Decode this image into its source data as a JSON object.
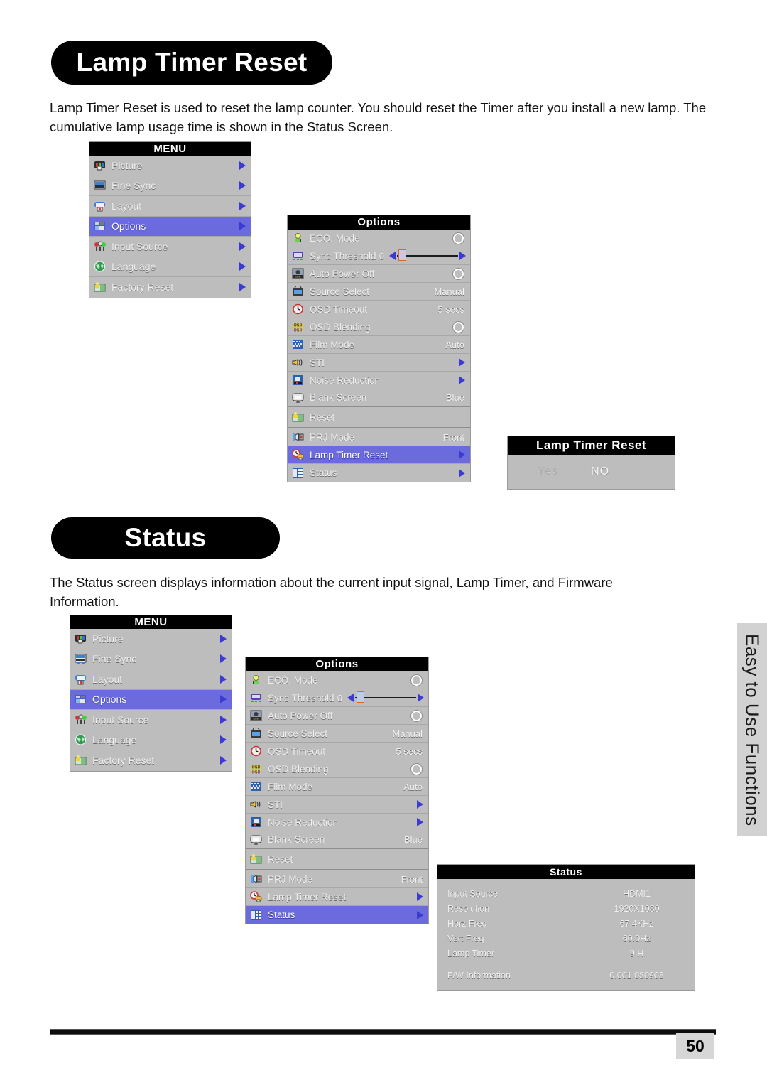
{
  "sections": {
    "lamp_timer_reset": {
      "heading": "Lamp Timer Reset",
      "paragraph": "Lamp Timer Reset is used to reset the lamp counter. You should reset the Timer after you install a new lamp. The cumulative lamp usage time is shown in the Status Screen."
    },
    "status": {
      "heading": "Status",
      "paragraph": "The Status screen displays information about the current input signal, Lamp Timer, and Firmware Information."
    }
  },
  "menu_panel": {
    "title": "MENU",
    "items": [
      {
        "label": "Picture",
        "icon": "picture-icon",
        "arrow": true,
        "selected": false
      },
      {
        "label": "Fine Sync",
        "icon": "fine-sync-icon",
        "arrow": true,
        "selected": false
      },
      {
        "label": "Layout",
        "icon": "layout-icon",
        "arrow": true,
        "selected": false
      },
      {
        "label": "Options",
        "icon": "options-icon",
        "arrow": true,
        "selected": true
      },
      {
        "label": "Input Source",
        "icon": "input-source-icon",
        "arrow": true,
        "selected": false
      },
      {
        "label": "Language",
        "icon": "language-icon",
        "arrow": true,
        "selected": false
      },
      {
        "label": "Factory Reset",
        "icon": "factory-reset-icon",
        "arrow": true,
        "selected": false
      }
    ]
  },
  "options_panel": {
    "title": "Options",
    "items": [
      {
        "label": "ECO. Mode",
        "icon": "eco-mode-icon",
        "control": "circle",
        "value": "",
        "selected": false,
        "group_end": false
      },
      {
        "label": "Sync Threshold",
        "icon": "sync-threshold-icon",
        "control": "slider",
        "value": "0",
        "selected": false,
        "group_end": false
      },
      {
        "label": "Auto Power Off",
        "icon": "auto-power-off-icon",
        "control": "circle",
        "value": "",
        "selected": false,
        "group_end": false
      },
      {
        "label": "Source Select",
        "icon": "source-select-icon",
        "control": "text",
        "value": "Manual",
        "selected": false,
        "group_end": false
      },
      {
        "label": "OSD Timeout",
        "icon": "osd-timeout-icon",
        "control": "text",
        "value": "5 secs",
        "selected": false,
        "group_end": false
      },
      {
        "label": "OSD Blending",
        "icon": "osd-blending-icon",
        "control": "circle",
        "value": "",
        "selected": false,
        "group_end": false
      },
      {
        "label": "Film Mode",
        "icon": "film-mode-icon",
        "control": "text",
        "value": "Auto",
        "selected": false,
        "group_end": false
      },
      {
        "label": "STI",
        "icon": "sti-icon",
        "control": "arrow",
        "value": "",
        "selected": false,
        "group_end": false
      },
      {
        "label": "Noise Reduction",
        "icon": "noise-reduction-icon",
        "control": "arrow",
        "value": "",
        "selected": false,
        "group_end": false
      },
      {
        "label": "Blank Screen",
        "icon": "blank-screen-icon",
        "control": "text",
        "value": "Blue",
        "selected": false,
        "group_end": true
      },
      {
        "label": "Reset",
        "icon": "reset-icon",
        "control": "none",
        "value": "",
        "selected": false,
        "group_end": true
      },
      {
        "label": "PRJ Mode",
        "icon": "prj-mode-icon",
        "control": "text",
        "value": "Front",
        "selected": false,
        "group_end": false
      },
      {
        "label": "Lamp Timer Reset",
        "icon": "lamp-timer-icon",
        "control": "arrow",
        "value": "",
        "selected": true,
        "group_end": false
      },
      {
        "label": "Status",
        "icon": "status-icon",
        "control": "arrow",
        "value": "",
        "selected": false,
        "group_end": false
      }
    ],
    "selected_first": "Lamp Timer Reset",
    "selected_second": "Status"
  },
  "lamp_timer_dialog": {
    "title": "Lamp Timer Reset",
    "yes_label": "Yes",
    "no_label": "NO"
  },
  "status_panel": {
    "title": "Status",
    "rows": [
      {
        "key": "Input Source",
        "value": "HDMI1"
      },
      {
        "key": "Resolution",
        "value": "1920X1080"
      },
      {
        "key": "Horz Freq",
        "value": "67.4KHz"
      },
      {
        "key": "Vert Freq",
        "value": "60.0Hz"
      },
      {
        "key": "Lamp Timer",
        "value": "9 H"
      },
      {
        "key": "F/W Information",
        "value": "0.001.080908"
      }
    ]
  },
  "side_tab": {
    "label": "Easy to Use Functions"
  },
  "footer": {
    "page_number": "50"
  },
  "colors": {
    "panel_bg": "#bdbdbd",
    "title_bg": "#000000",
    "highlight": "#6b6bdd",
    "arrow": "#3b3bd4",
    "side_tab_bg": "#d2d2d2"
  }
}
